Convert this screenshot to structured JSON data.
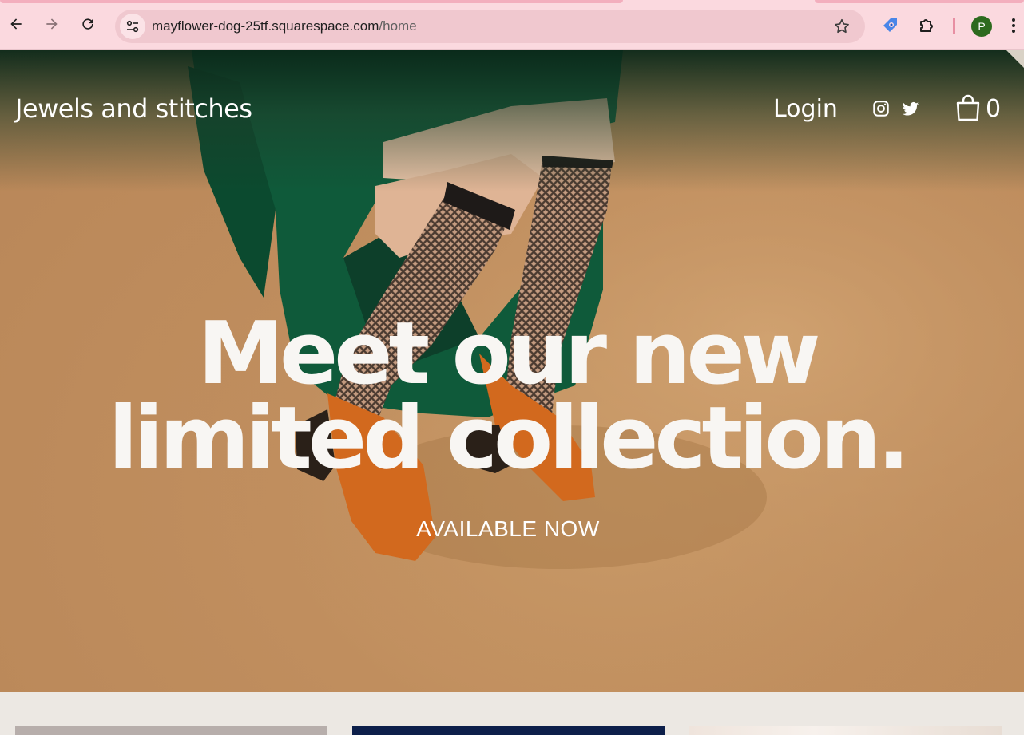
{
  "browser": {
    "url_host": "mayflower-dog-25tf.squarespace.com",
    "url_path": "/home",
    "profile_initial": "P",
    "colors": {
      "chrome_bg": "#fbd9df",
      "omnibox_bg": "#f0c8cf",
      "avatar_bg": "#2d6a1e"
    }
  },
  "site": {
    "brand": "Jewels and stitches",
    "nav": {
      "login_label": "Login",
      "social_icons": [
        "instagram-icon",
        "twitter-icon"
      ],
      "cart_count": "0"
    },
    "hero": {
      "headline_line1": "Meet our new",
      "headline_line2": "limited collection.",
      "cta_label": "AVAILABLE NOW"
    },
    "colors": {
      "page_bg": "#ece8e3",
      "hero_tan": "#c08e5e",
      "dress_green": "#0f5a3a",
      "shoe_orange": "#d2691e"
    }
  }
}
